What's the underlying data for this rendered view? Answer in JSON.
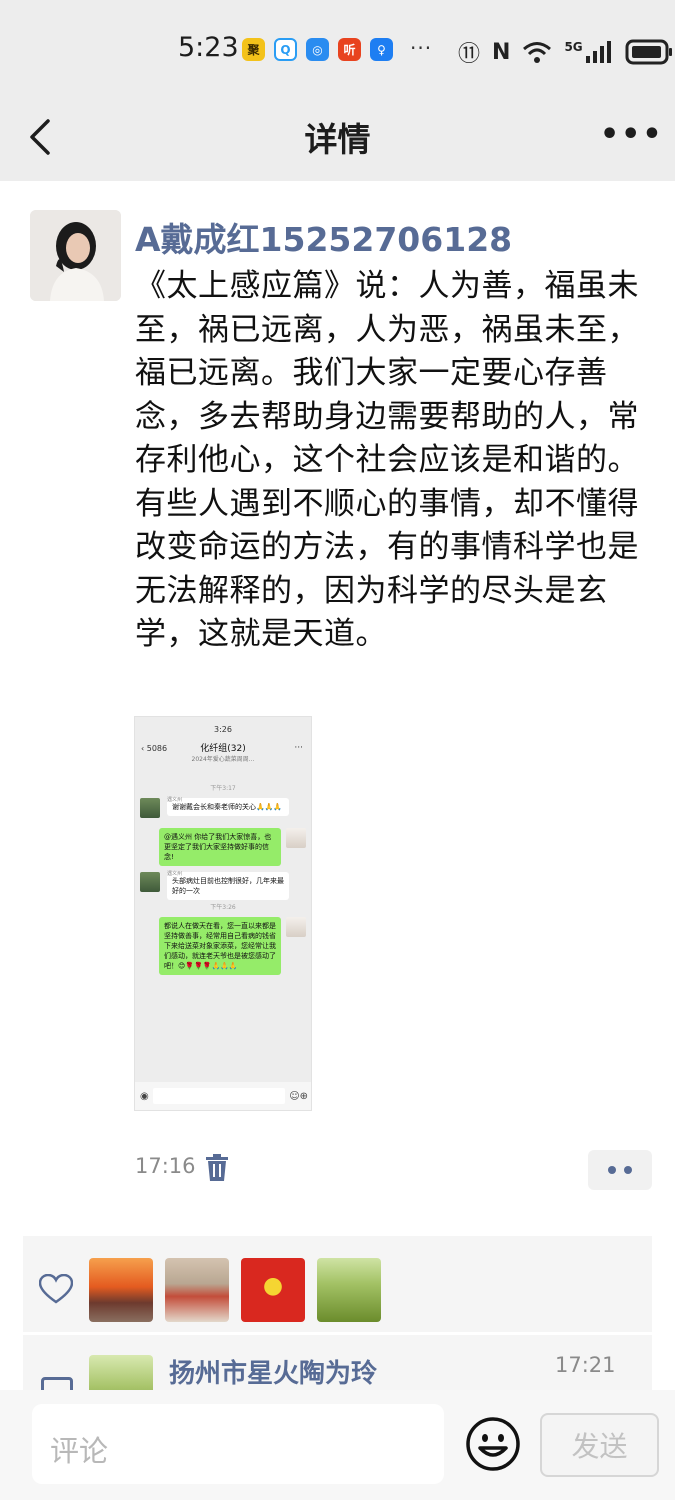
{
  "status_bar": {
    "time": "5:23",
    "app_icons": [
      "聚",
      "Q",
      "◎",
      "听",
      "♀"
    ],
    "overflow": "···",
    "network": "5G",
    "system_icons": [
      "⑪",
      "N",
      "wifi",
      "signal",
      "battery"
    ]
  },
  "nav": {
    "title": "详情"
  },
  "post": {
    "author": "A戴成红15252706128",
    "text": "《太上感应篇》说：人为善，福虽未至，祸已远离，人为恶，祸虽未至，福已远离。我们大家一定要心存善念，多去帮助身边需要帮助的人，常存利他心，这个社会应该是和谐的。\n有些人遇到不顺心的事情，却不懂得改变命运的方法，有的事情科学也是无法解释的，因为科学的尽头是玄学，这就是天道。",
    "time": "17:16"
  },
  "screenshot": {
    "status_time": "3:26",
    "back_count": "5086",
    "title": "化纤组(32)",
    "subtitle": "2024年爱心蔬菜周周...",
    "time1": "下午3:17",
    "sender1": "遇义州",
    "msg1": "谢谢戴会长和秦老师的关心🙏🙏🙏",
    "msg2": "@遇义州  你给了我们大家惊喜，也更坚定了我们大家坚持做好事的信念!",
    "sender2": "遇义州",
    "msg3": "头部病灶目前也控制很好，几年来最好的一次",
    "time2": "下午3:26",
    "msg4": "都说人在做天在看，您一直以来都是坚持做善事，经常用自己看病的钱省下来给送菜对象家添菜，您经常让我们感动，就连老天爷也是被您感动了吧！😊🌹🌹🌹🙏🙏🙏"
  },
  "likes": {
    "avatars": [
      "sunset",
      "woman-poster",
      "heart-logo",
      "field"
    ]
  },
  "comment": {
    "name": "扬州市星火陶为玲",
    "time": "17:21"
  },
  "bottom_bar": {
    "placeholder": "评论",
    "send_label": "发送"
  },
  "colors": {
    "link_blue": "#576b95",
    "bar_gray": "#ededed",
    "bubble_green": "#95ec69"
  }
}
